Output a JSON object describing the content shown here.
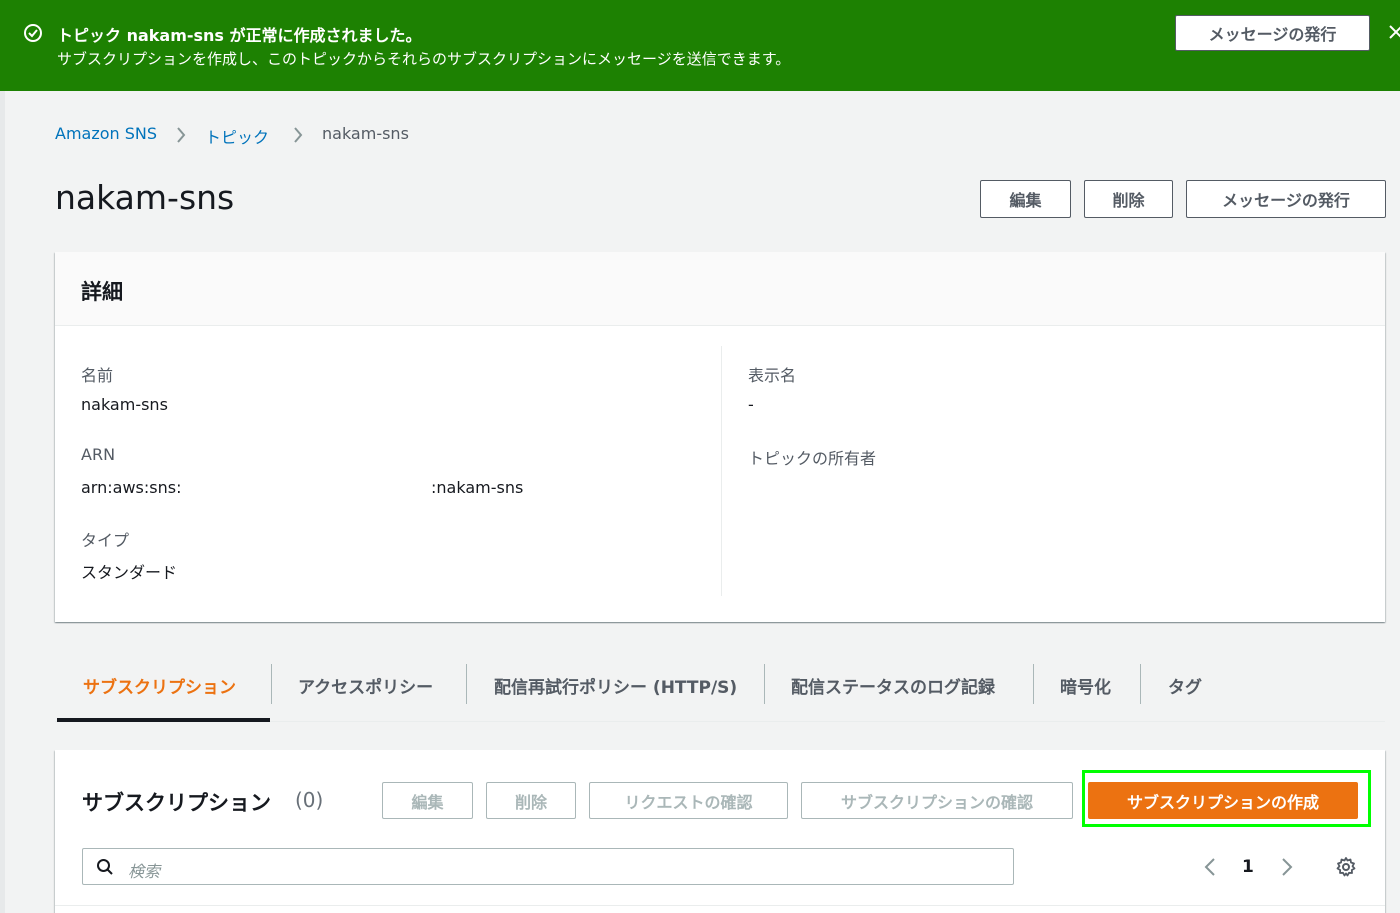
{
  "flash": {
    "title": "トピック nakam-sns が正常に作成されました。",
    "message": "サブスクリプションを作成し、このトピックからそれらのサブスクリプションにメッセージを送信できます。",
    "publish_label": "メッセージの発行"
  },
  "breadcrumb": {
    "items": [
      "Amazon SNS",
      "トピック",
      "nakam-sns"
    ]
  },
  "page": {
    "title": "nakam-sns",
    "edit_label": "編集",
    "delete_label": "削除",
    "publish_label": "メッセージの発行"
  },
  "details": {
    "header": "詳細",
    "name_label": "名前",
    "name_value": "nakam-sns",
    "arn_label": "ARN",
    "arn_prefix": "arn:aws:sns:",
    "arn_suffix": ":nakam-sns",
    "type_label": "タイプ",
    "type_value": "スタンダード",
    "display_name_label": "表示名",
    "display_name_value": "-",
    "owner_label": "トピックの所有者"
  },
  "tabs": [
    {
      "label": "サブスクリプション",
      "active": true
    },
    {
      "label": "アクセスポリシー"
    },
    {
      "label": "配信再試行ポリシー (HTTP/S)"
    },
    {
      "label": "配信ステータスのログ記録"
    },
    {
      "label": "暗号化"
    },
    {
      "label": "タグ"
    }
  ],
  "subscriptions": {
    "title": "サブスクリプション",
    "count": "(0)",
    "edit_label": "編集",
    "delete_label": "削除",
    "request_confirm_label": "リクエストの確認",
    "confirm_label": "サブスクリプションの確認",
    "create_label": "サブスクリプションの作成",
    "search_placeholder": "検索",
    "page_number": "1"
  },
  "colors": {
    "success_green": "#1d8102",
    "accent_orange": "#ec7211",
    "link_blue": "#0073bb",
    "highlight_green": "#00ff00"
  }
}
